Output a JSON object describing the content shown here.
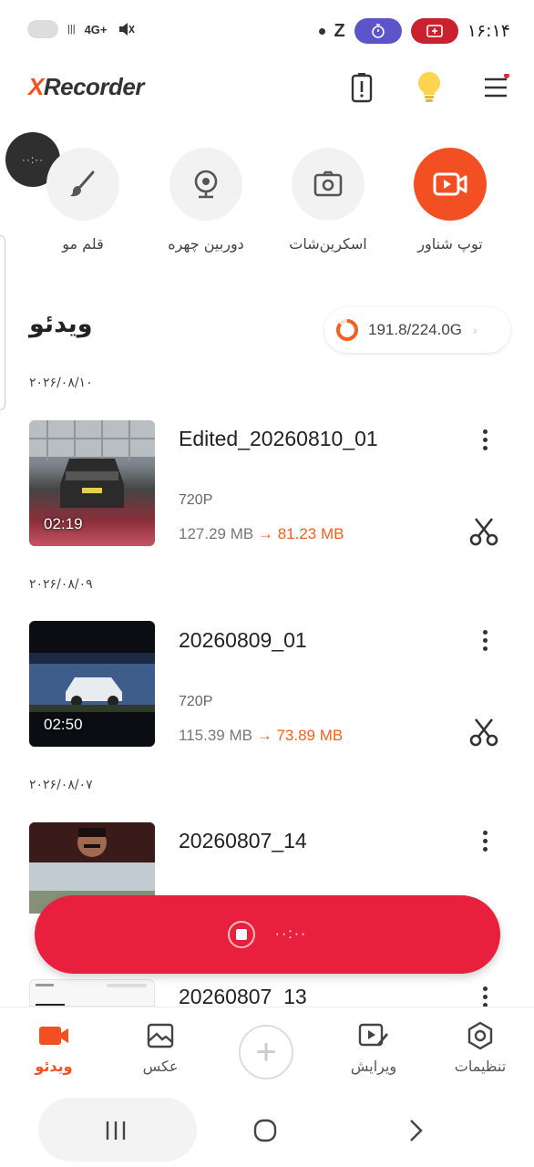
{
  "status_bar": {
    "time": "۱۶:۱۴",
    "network": "4G+",
    "icons": [
      "battery-icon",
      "signal-icon",
      "mute-icon",
      "timer-icon",
      "screen-record-icon",
      "z-icon"
    ]
  },
  "app": {
    "logo_prefix": "X",
    "logo_rest": "Recorder",
    "accent_color": "#f25022",
    "record_bar_color": "#e8203e"
  },
  "bubble": {
    "text": "··:··"
  },
  "tools": [
    {
      "label": "توپ شناور",
      "icon": "video-camera-icon",
      "active": true
    },
    {
      "label": "اسکرین‌شات",
      "icon": "screenshot-icon",
      "active": false
    },
    {
      "label": "دوربین چهره",
      "icon": "webcam-icon",
      "active": false
    },
    {
      "label": "قلم مو",
      "icon": "brush-icon",
      "active": false
    }
  ],
  "section": {
    "title": "ویدئو",
    "storage": "191.8/224.0G"
  },
  "videos": [
    {
      "date": "۲۰۲۶/۰۸/۱۰",
      "title": "Edited_20260810_01",
      "resolution": "720P",
      "size_old": "127.29 MB",
      "size_new": "81.23 MB",
      "duration": "02:19"
    },
    {
      "date": "۲۰۲۶/۰۸/۰۹",
      "title": "20260809_01",
      "resolution": "720P",
      "size_old": "115.39 MB",
      "size_new": "73.89 MB",
      "duration": "02:50"
    },
    {
      "date": "۲۰۲۶/۰۸/۰۷",
      "title": "20260807_14"
    },
    {
      "title": "20260807_13"
    }
  ],
  "record_bar": {
    "dots": "··:··"
  },
  "bottom_nav": [
    {
      "label": "تنظیمات",
      "icon": "settings-icon",
      "active": false
    },
    {
      "label": "ویرایش",
      "icon": "edit-video-icon",
      "active": false
    },
    {
      "label": "عکس",
      "icon": "image-icon",
      "active": false
    },
    {
      "label": "ویدئو",
      "icon": "video-icon",
      "active": true
    }
  ]
}
